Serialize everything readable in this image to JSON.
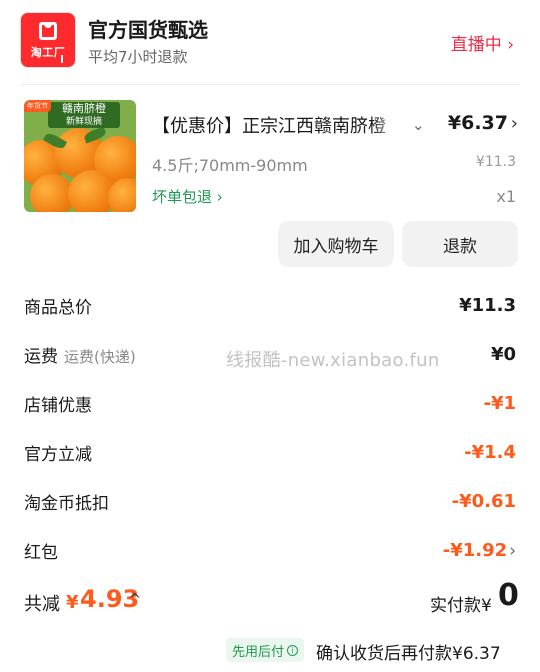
{
  "shop": {
    "logo_text": "淘工厂",
    "name": "官方国货甄选",
    "subtitle": "平均7小时退款",
    "live_label": "直播中",
    "live_chevron": "›"
  },
  "product": {
    "title": "【优惠价】正宗江西赣南脐橙",
    "image_banner": "赣南脐橙",
    "image_banner_sub": "新鲜现摘",
    "image_tag": "年货节",
    "price": "¥6.37",
    "spec": "4.5斤;70mm-90mm",
    "original_price": "¥11.3",
    "guarantee": "坏单包退",
    "quantity": "x1",
    "add_to_cart_label": "加入购物车",
    "refund_label": "退款",
    "caret": "⌄",
    "chevron": "›"
  },
  "summary": {
    "rows": [
      {
        "label": "商品总价",
        "sub": "",
        "value": "¥11.3",
        "discount": false
      },
      {
        "label": "运费",
        "sub": "运费(快递)",
        "value": "¥0",
        "discount": false
      },
      {
        "label": "店铺优惠",
        "sub": "",
        "value": "-¥1",
        "discount": true
      },
      {
        "label": "官方立减",
        "sub": "",
        "value": "-¥1.4",
        "discount": true
      },
      {
        "label": "淘金币抵扣",
        "sub": "",
        "value": "-¥0.61",
        "discount": true
      },
      {
        "label": "红包",
        "sub": "",
        "value": "-¥1.92",
        "discount": true
      }
    ]
  },
  "watermark": "线报酷-new.xianbao.fun",
  "totals": {
    "saved_label": "共减",
    "saved_currency": "¥",
    "saved_value": "4.93",
    "collapse_chevron": "^",
    "paid_label": "实付款¥",
    "paid_value": "0"
  },
  "footer": {
    "badge": "先用后付",
    "info_icon": "i",
    "pay_after_text": "确认收货后再付款¥6.37"
  },
  "colors": {
    "brand_red": "#ff2a2e",
    "live_red": "#e8304a",
    "discount_orange": "#ff5a1a",
    "green": "#1d9a52"
  }
}
